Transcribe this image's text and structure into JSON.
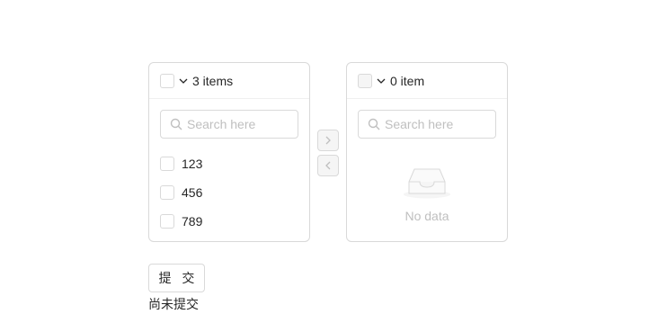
{
  "left_panel": {
    "count_label": "3 items",
    "search_placeholder": "Search here",
    "items": [
      {
        "label": "123"
      },
      {
        "label": "456"
      },
      {
        "label": "789"
      }
    ]
  },
  "right_panel": {
    "count_label": "0 item",
    "search_placeholder": "Search here",
    "empty_text": "No data"
  },
  "operations": {
    "move_right_icon": "chevron-right-icon",
    "move_left_icon": "chevron-left-icon"
  },
  "submit": {
    "label": "提 交"
  },
  "status_text": "尚未提交"
}
